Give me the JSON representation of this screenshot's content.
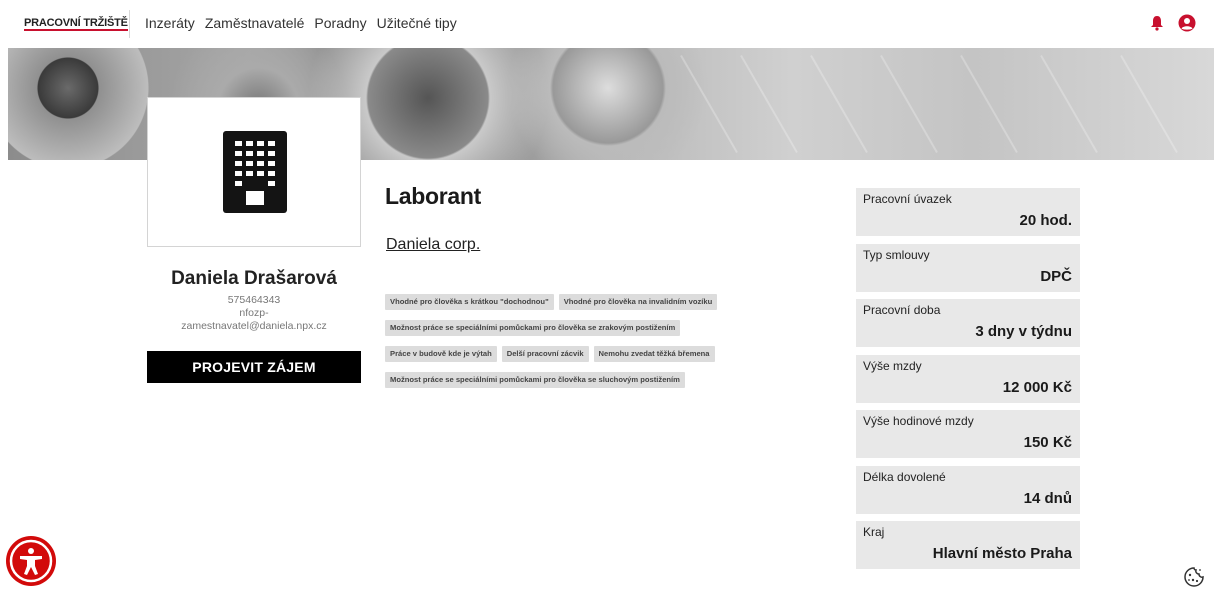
{
  "nav": {
    "logo_text": "PRACOVNÍ TRŽIŠTĚ",
    "links": [
      "Inzeráty",
      "Zaměstnavatelé",
      "Poradny",
      "Užitečné tipy"
    ],
    "icons": [
      "bell-icon",
      "user-circle-icon"
    ],
    "accent_color": "#c8102e"
  },
  "employer": {
    "contact_name": "Daniela Drašarová",
    "phone": "575464343",
    "email_line1": "nfozp-",
    "email_line2": "zamestnavatel@daniela.npx.cz",
    "interest_button": "PROJEVIT ZÁJEM"
  },
  "job": {
    "title": "Laborant",
    "company": "Daniela corp.",
    "tags": [
      "Vhodné pro člověka s krátkou \"dochodnou\"",
      "Vhodné pro člověka na invalidním vozíku",
      "Možnost práce se speciálními pomůckami pro člověka se zrakovým postižením",
      "Práce v budově kde je výtah",
      "Delší pracovní zácvik",
      "Nemohu zvedat těžká břemena",
      "Možnost práce se speciálními pomůckami pro člověka se sluchovým postižením"
    ]
  },
  "details": [
    {
      "label": "Pracovní úvazek",
      "value": "20 hod."
    },
    {
      "label": "Typ smlouvy",
      "value": "DPČ"
    },
    {
      "label": "Pracovní doba",
      "value": "3 dny v týdnu"
    },
    {
      "label": "Výše mzdy",
      "value": "12 000 Kč"
    },
    {
      "label": "Výše hodinové mzdy",
      "value": "150 Kč"
    },
    {
      "label": "Délka dovolené",
      "value": "14 dnů"
    },
    {
      "label": "Kraj",
      "value": "Hlavní město Praha"
    }
  ],
  "widgets": {
    "accessibility_icon": "accessibility-icon",
    "cookie_icon": "cookie-icon",
    "accessibility_color": "#d20a0a"
  }
}
